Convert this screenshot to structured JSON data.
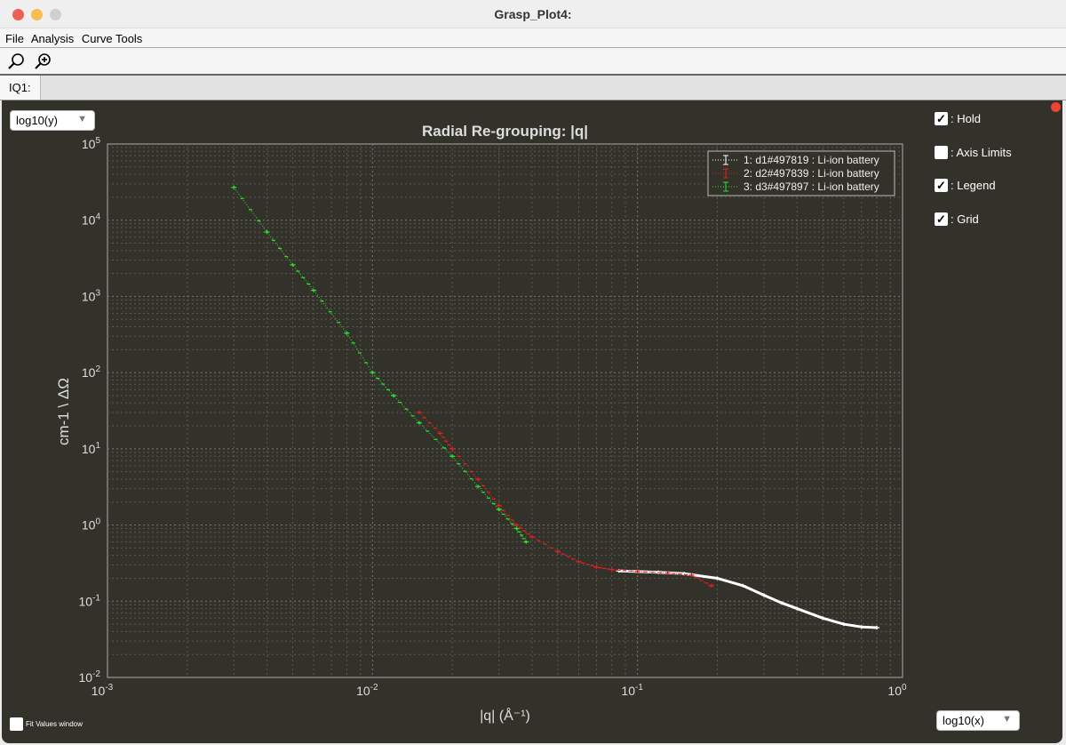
{
  "window": {
    "title": "Grasp_Plot4:"
  },
  "menu": [
    "File",
    "Analysis",
    "Curve Tools"
  ],
  "toolbar": {
    "zoom": "zoom-icon",
    "zoom_in": "zoom-in-icon"
  },
  "tab": "IQ1:",
  "y_scale_select": "log10(y)",
  "x_scale_select": "log10(x)",
  "checkboxes": [
    {
      "label": ": Hold",
      "checked": true
    },
    {
      "label": ": Axis Limits",
      "checked": false
    },
    {
      "label": ": Legend",
      "checked": true
    },
    {
      "label": ": Grid",
      "checked": true
    }
  ],
  "fit_values": {
    "label": "Fit Values window",
    "checked": false
  },
  "colors": {
    "bg": "#33322a",
    "s1": "#ffffff",
    "s2": "#e02020",
    "s3": "#30e030"
  },
  "chart_data": {
    "type": "scatter",
    "title": "Radial Re-grouping: |q|",
    "xlabel": "|q|  (Å⁻¹)",
    "ylabel": "cm-1 \\ ΔΩ",
    "xscale": "log",
    "yscale": "log",
    "xlim": [
      0.001,
      1
    ],
    "ylim": [
      0.01,
      100000
    ],
    "xticks": [
      "10-3",
      "10-2",
      "10-1",
      "100"
    ],
    "yticks": [
      "10-2",
      "10-1",
      "100",
      "101",
      "102",
      "103",
      "104",
      "105"
    ],
    "grid": true,
    "legend_position": "top-right",
    "series": [
      {
        "name": "1: d1#497819 : Li-ion battery",
        "color": "#ffffff",
        "points": [
          [
            0.085,
            0.25
          ],
          [
            0.1,
            0.245
          ],
          [
            0.12,
            0.24
          ],
          [
            0.15,
            0.23
          ],
          [
            0.2,
            0.2
          ],
          [
            0.25,
            0.16
          ],
          [
            0.3,
            0.12
          ],
          [
            0.35,
            0.095
          ],
          [
            0.4,
            0.08
          ],
          [
            0.5,
            0.06
          ],
          [
            0.6,
            0.05
          ],
          [
            0.7,
            0.046
          ],
          [
            0.8,
            0.045
          ]
        ]
      },
      {
        "name": "2: d2#497839 : Li-ion battery",
        "color": "#e02020",
        "points": [
          [
            0.015,
            30
          ],
          [
            0.018,
            16
          ],
          [
            0.02,
            10
          ],
          [
            0.025,
            4
          ],
          [
            0.03,
            1.8
          ],
          [
            0.035,
            1.0
          ],
          [
            0.04,
            0.7
          ],
          [
            0.05,
            0.45
          ],
          [
            0.06,
            0.33
          ],
          [
            0.07,
            0.28
          ],
          [
            0.08,
            0.26
          ],
          [
            0.1,
            0.245
          ],
          [
            0.13,
            0.235
          ],
          [
            0.16,
            0.22
          ],
          [
            0.19,
            0.16
          ]
        ]
      },
      {
        "name": "3: d3#497897 : Li-ion battery",
        "color": "#30e030",
        "points": [
          [
            0.003,
            27000
          ],
          [
            0.004,
            7000
          ],
          [
            0.005,
            2600
          ],
          [
            0.006,
            1200
          ],
          [
            0.008,
            330
          ],
          [
            0.01,
            100
          ],
          [
            0.012,
            50
          ],
          [
            0.015,
            22
          ],
          [
            0.02,
            8
          ],
          [
            0.025,
            3.2
          ],
          [
            0.03,
            1.6
          ],
          [
            0.035,
            0.9
          ],
          [
            0.038,
            0.6
          ]
        ]
      }
    ]
  }
}
